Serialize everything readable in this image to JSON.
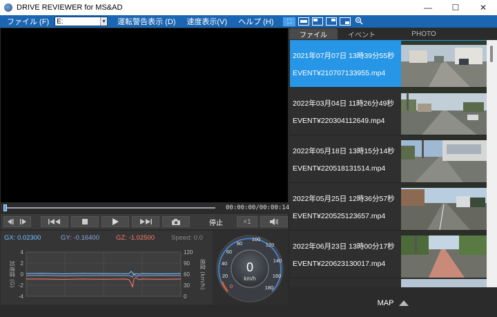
{
  "window": {
    "title": "DRIVE REVIEWER for MS&AD",
    "minimize": "—",
    "maximize": "☐",
    "close": "✕"
  },
  "menu": {
    "file": "ファイル (F)",
    "drive_value": "E:",
    "warning_display": "運転警告表示 (D)",
    "speed_display": "速度表示(V)",
    "help": "ヘルプ (H)"
  },
  "player": {
    "timecode": "00:00:00/00:00:14",
    "stop_label": "停止",
    "rate_label": "×1"
  },
  "sensor": {
    "gx": "GX: 0.02300",
    "gy": "GY: -0.16400",
    "gz": "GZ: -1.02500",
    "speed": "Speed: 0.0",
    "left_axis_label": "加速度 (G)",
    "right_axis_label": "速度 (km/h)",
    "left_ticks": [
      "4",
      "2",
      "0",
      "-2",
      "-4"
    ],
    "right_ticks": [
      "120",
      "90",
      "60",
      "30",
      "0"
    ]
  },
  "speedometer": {
    "value": "0",
    "unit": "km/h",
    "ticks": [
      "0",
      "20",
      "40",
      "60",
      "80",
      "100",
      "120",
      "140",
      "160",
      "180"
    ]
  },
  "tabs": [
    "ファイル",
    "イベント",
    "PHOTO"
  ],
  "files": [
    {
      "date": "2021年07月07日 13時39分55秒",
      "file": "EVENT¥210707133955.mp4"
    },
    {
      "date": "2022年03月04日 11時26分49秒",
      "file": "EVENT¥220304112649.mp4"
    },
    {
      "date": "2022年05月18日 13時15分14秒",
      "file": "EVENT¥220518131514.mp4"
    },
    {
      "date": "2022年05月25日 12時36分57秒",
      "file": "EVENT¥220525123657.mp4"
    },
    {
      "date": "2022年06月23日 13時00分17秒",
      "file": "EVENT¥220623130017.mp4"
    }
  ],
  "map": {
    "label": "MAP"
  },
  "colors": {
    "accent": "#1b66b2",
    "selected": "#2796e6",
    "gx": "#6fc3ff",
    "gy": "#8da6e8",
    "gz": "#ff7b6b"
  }
}
